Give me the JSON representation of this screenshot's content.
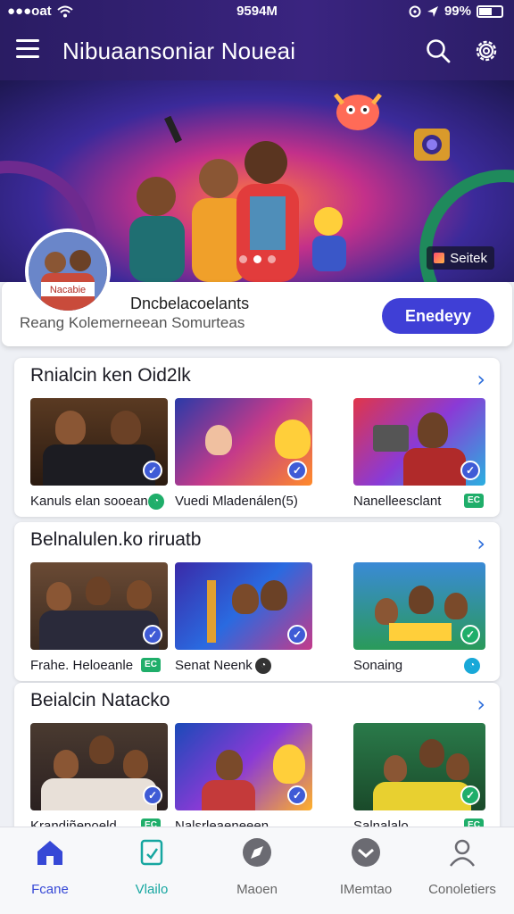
{
  "status_bar": {
    "carrier": "●●●oat",
    "time": "9594M",
    "battery": "99%"
  },
  "header": {
    "title": "Nibuaansoniar Noueai"
  },
  "hero": {
    "badge": "Seitek"
  },
  "profile": {
    "avatar_text": "Nacabie",
    "name": "Dncbelacoelants",
    "subtitle": "Reang Kolemerneean Somurteas",
    "follow_label": "Enedeyy"
  },
  "sections": [
    {
      "title": "Rnialcin ken Oid2lk",
      "items": [
        {
          "caption": "Kanuls elan sooean",
          "tag": "◔"
        },
        {
          "caption": "Vuedi Mladenálen(5)",
          "tag": ""
        },
        {
          "caption": "Nanelleesclant",
          "tag": "EC"
        }
      ]
    },
    {
      "title": "Belnalulen.ko riruatb",
      "items": [
        {
          "caption": "Frahe. Heloeanle",
          "tag": "EC"
        },
        {
          "caption": "Senat Neenk",
          "tag": "◔"
        },
        {
          "caption": "Sonaing",
          "tag": "◔"
        }
      ]
    },
    {
      "title": "Beialcin Natacko",
      "items": [
        {
          "caption": "Krandiñepoeld",
          "tag": "EC"
        },
        {
          "caption": "Nalsrleaeneeen",
          "tag": ""
        },
        {
          "caption": "Salnalalo",
          "tag": "EC"
        }
      ]
    }
  ],
  "bottom_nav": [
    {
      "label": "Fcane"
    },
    {
      "label": "Vlailo"
    },
    {
      "label": "Maoen"
    },
    {
      "label": "IMemtao"
    },
    {
      "label": "Conoletiers"
    }
  ],
  "colors": {
    "header_bg": "#2f2070",
    "accent": "#3f3fd6",
    "link": "#2f6fdb",
    "teal": "#16a6a0"
  }
}
